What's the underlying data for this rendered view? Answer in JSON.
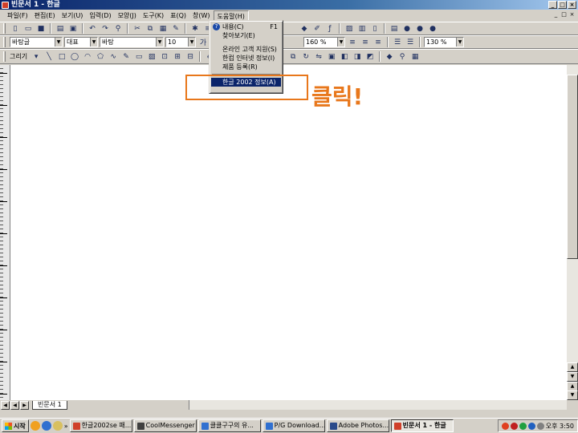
{
  "window": {
    "title": "빈문서 1 - 한글",
    "buttons": [
      "_",
      "□",
      "×"
    ]
  },
  "menubar": {
    "items": [
      "파일(F)",
      "편집(E)",
      "보기(U)",
      "입력(D)",
      "모양(J)",
      "도구(K)",
      "표(Q)",
      "창(W)",
      "도움말(H)"
    ],
    "active_index": 8
  },
  "toolbar2": {
    "style_combo": "바탕글",
    "lang_combo": "대표",
    "font_combo": "바탕",
    "size_combo": "10",
    "zoom_combo_a": "160 %",
    "zoom_combo_b": "130 %"
  },
  "toolbar3": {
    "draw_label": "그리기"
  },
  "help_menu": {
    "items": [
      {
        "label": "내용(C)",
        "shortcut": "F1"
      },
      {
        "label": "찾아보기(E)"
      },
      {
        "label": "온라인 고객 지원(S)"
      },
      {
        "label": "한컴 인터넷 정보(I)"
      },
      {
        "label": "제품 등록(R)"
      },
      {
        "label": "한글 2002 정보(A)"
      }
    ],
    "highlighted_index": 5
  },
  "annotation": {
    "text": "클릭!",
    "color": "#e8771b"
  },
  "document_tab": "빈문서 1",
  "taskbar": {
    "start_label": "시작",
    "buttons": [
      "한글2002se 패...",
      "CoolMessenger",
      "클클구구의 유...",
      "P/G Download...",
      "Adobe Photos...",
      "빈문서 1 - 한글"
    ],
    "active_index": 5,
    "clock": "오후 3:50"
  },
  "colors": {
    "title_bar": "#0a246a",
    "menu_highlight": "#0a246a",
    "annotation": "#e8771b"
  }
}
